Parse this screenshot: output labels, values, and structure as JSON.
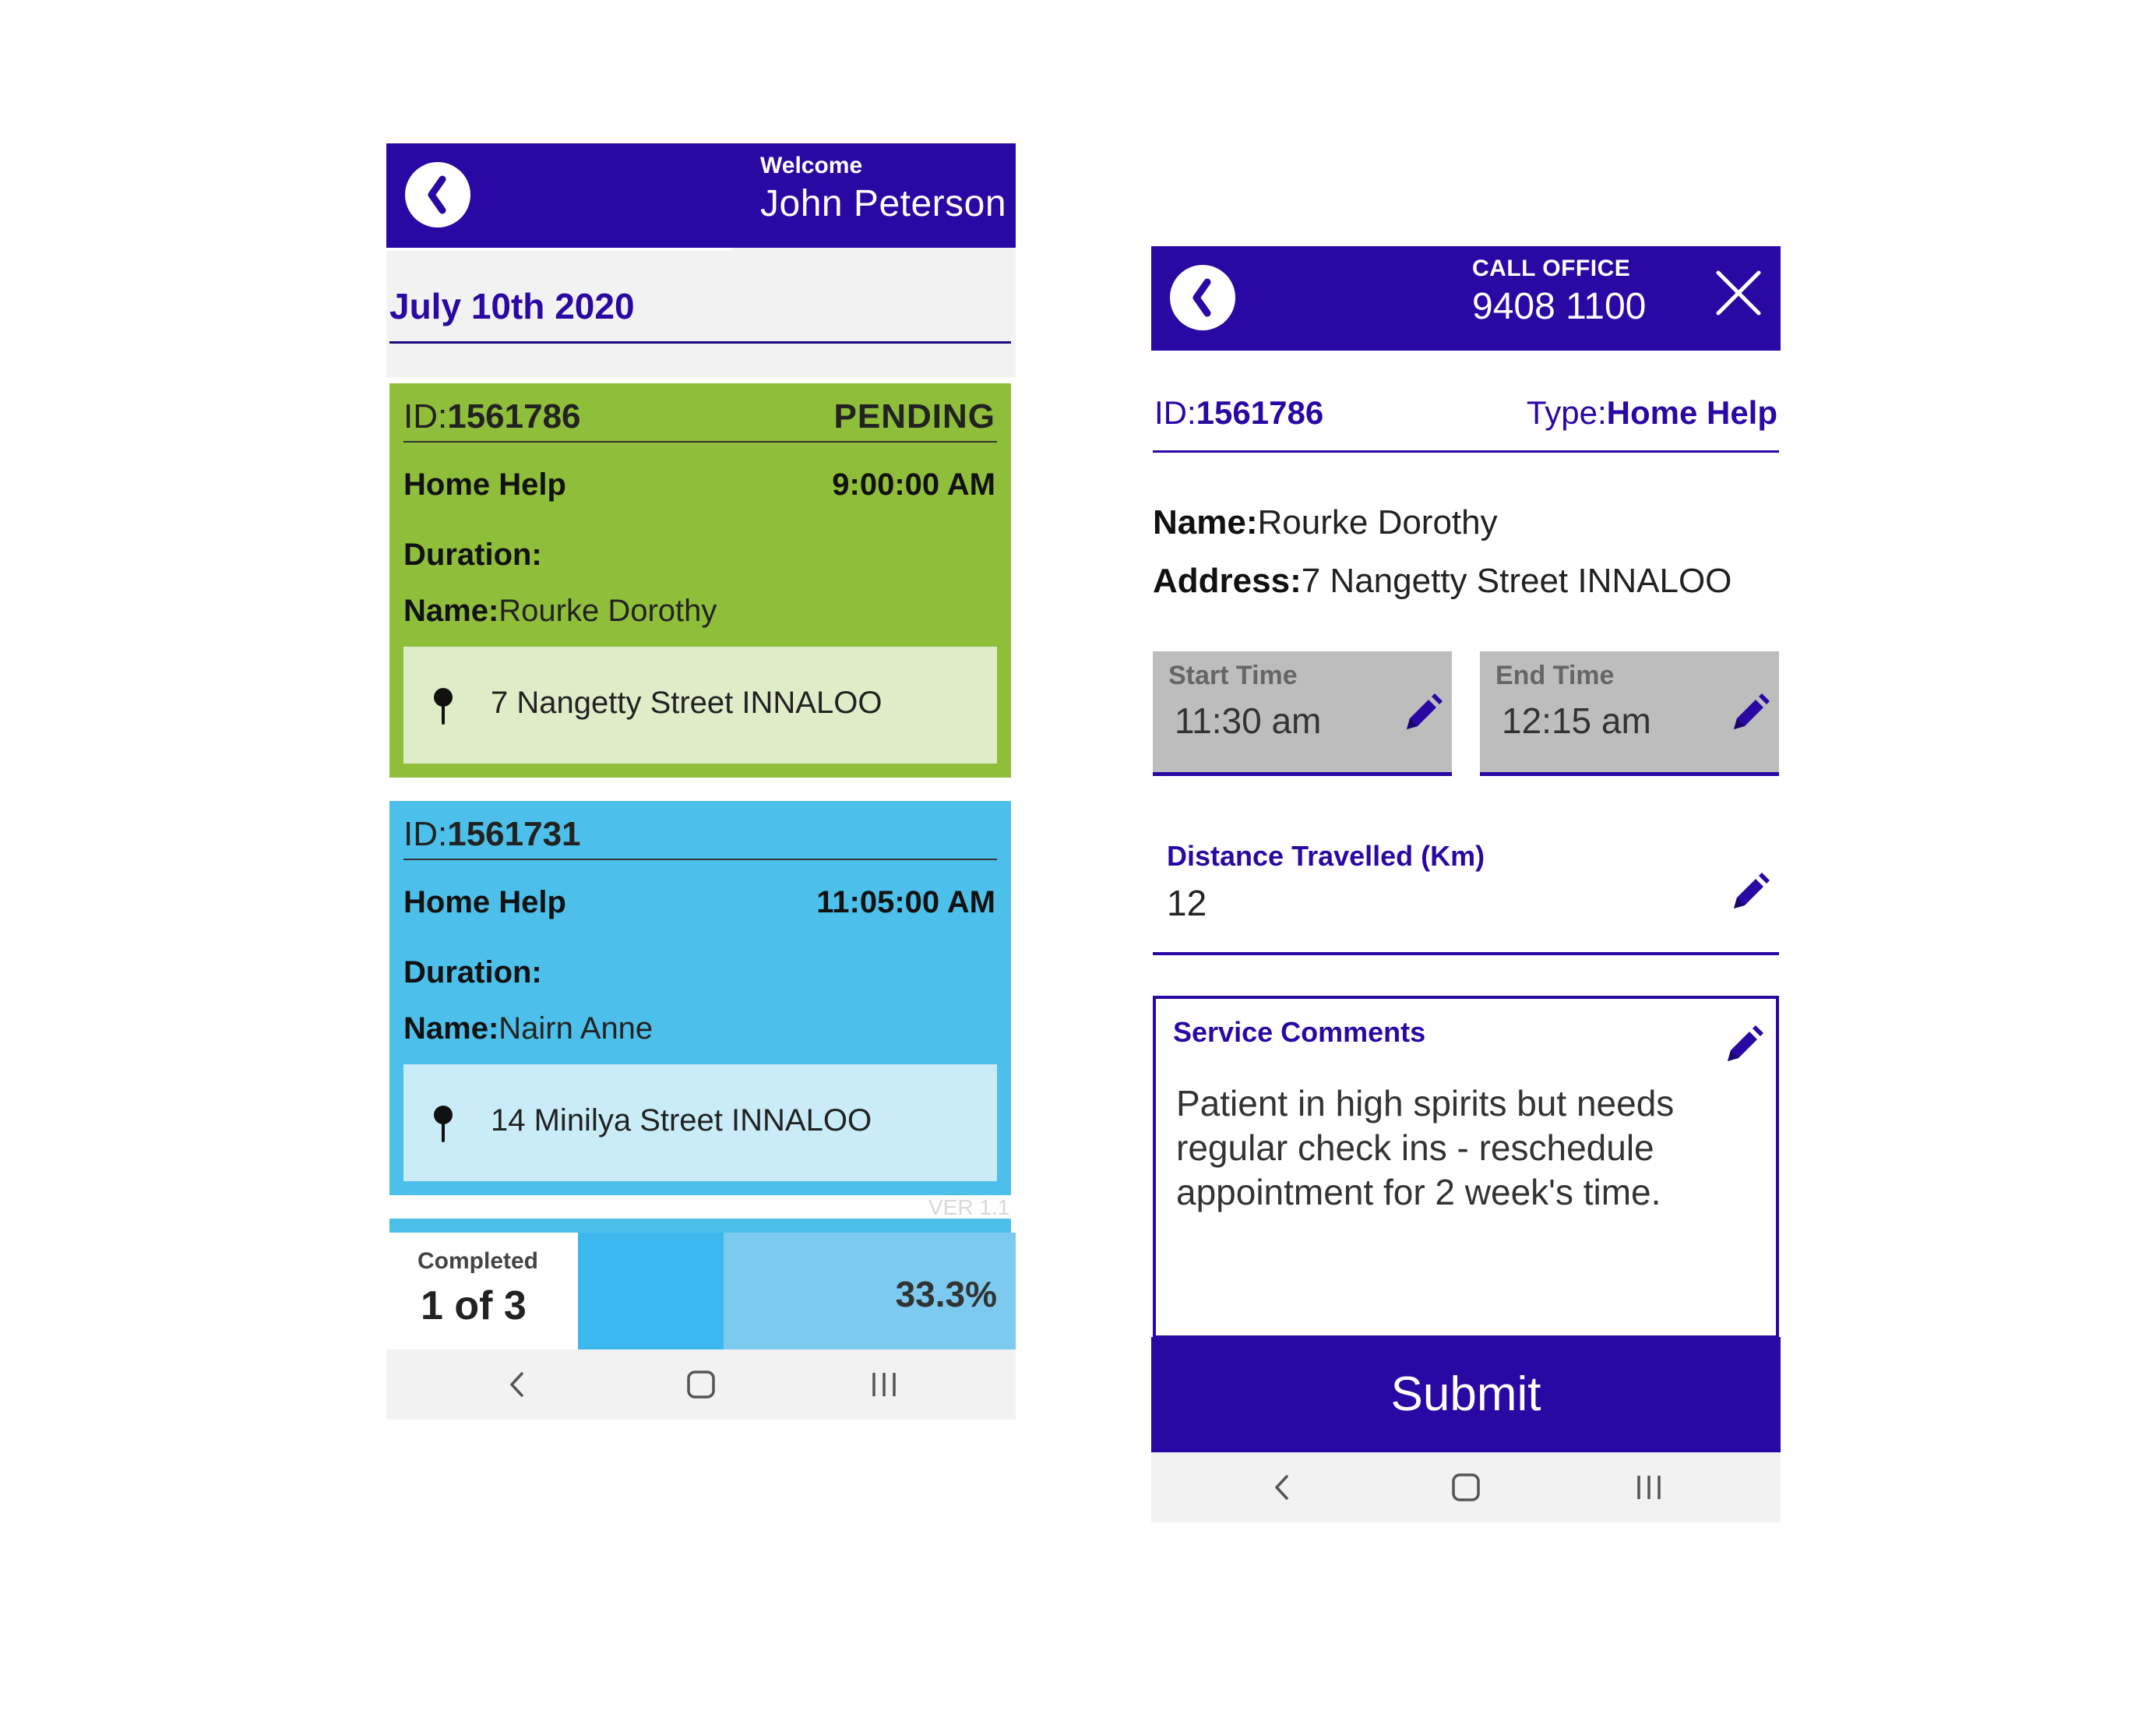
{
  "screen1": {
    "header": {
      "welcome_label": "Welcome",
      "user_name": "John Peterson"
    },
    "date_title": "July 10th 2020",
    "jobs": [
      {
        "id_label": "ID:",
        "id": "1561786",
        "status": "PENDING",
        "type": "Home Help",
        "time": "9:00:00 AM",
        "duration_label": "Duration:",
        "name_label": "Name:",
        "name": "Rourke Dorothy",
        "address": "7 Nangetty Street INNALOO",
        "color": "#8fbe3a"
      },
      {
        "id_label": "ID:",
        "id": "1561731",
        "status": "",
        "type": "Home Help",
        "time": "11:05:00 AM",
        "duration_label": "Duration:",
        "name_label": "Name:",
        "name": "Nairn Anne",
        "address": "14 Minilya Street INNALOO",
        "color": "#4cc0ea"
      }
    ],
    "version": "VER 1.1",
    "progress": {
      "label": "Completed",
      "count_text": "1 of 3",
      "percent_text": "33.3%",
      "fraction": 0.333
    }
  },
  "screen2": {
    "header": {
      "call_label": "CALL OFFICE",
      "phone_number": "9408 1100"
    },
    "job": {
      "id_label": "ID:",
      "id": "1561786",
      "type_label": "Type:",
      "type": "Home Help",
      "name_label": "Name:",
      "name": "Rourke Dorothy",
      "address_label": "Address:",
      "address": "7 Nangetty Street INNALOO"
    },
    "start_time": {
      "label": "Start Time",
      "value": "11:30 am"
    },
    "end_time": {
      "label": "End Time",
      "value": "12:15 am"
    },
    "distance": {
      "label": "Distance Travelled (Km)",
      "value": "12"
    },
    "comments": {
      "label": "Service Comments",
      "text": "Patient in high spirits but needs regular check ins - reschedule appointment for 2 week's time."
    },
    "submit_label": "Submit"
  },
  "colors": {
    "brand": "#2a08a3",
    "pending": "#8fbe3a",
    "scheduled": "#4cc0ea",
    "progress": "#3db8ee"
  },
  "icons": [
    "back-chevron-icon",
    "close-icon",
    "map-pin-icon",
    "edit-pencil-icon",
    "nav-back-icon",
    "nav-home-icon",
    "nav-recents-icon"
  ]
}
